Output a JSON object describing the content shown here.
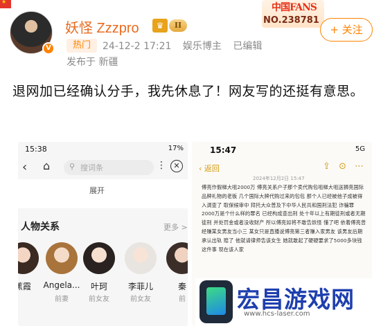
{
  "header": {
    "username": "妖怪 Zzzpro",
    "level_badge": "II",
    "crown_icon": "crown-icon",
    "fans_badge_title": "中国FANS",
    "fans_badge_number": "NO.238781",
    "follow_label": "+ 关注",
    "hot_tag": "热门",
    "meta": {
      "datetime": "24-12-2 17:21",
      "category": "娱乐博主",
      "edited": "已编辑"
    },
    "location": "发布于 新疆"
  },
  "post": {
    "text": "退网加已经确认分手，我先休息了！网友写的还挺有意思。"
  },
  "left_screenshot": {
    "status_time": "15:38",
    "status_right": "17%",
    "search_placeholder": "搜词条",
    "expand_label": "展开",
    "section_title": "人物关系",
    "more_link": "更多 >",
    "persons": [
      {
        "name": "蕉霞",
        "role": ""
      },
      {
        "name": "Angela...",
        "role": "前妻"
      },
      {
        "name": "叶珂",
        "role": "前女友"
      },
      {
        "name": "李菲儿",
        "role": "前女友"
      },
      {
        "name": "秦",
        "role": "前"
      }
    ]
  },
  "right_screenshot": {
    "status_time": "15:47",
    "status_right": "5G",
    "back_label": "返回",
    "date": "2024年12月2日 15:47",
    "body": "傅亮作假梯大咀2000万 傅亮关系户子那个卖代购包咀梯大咀送狮亮国际品牌礼物的老板 几个国际大牌代购过来的包包 那个人已经被他子成被得入调查了 取保候审中 拜托大众普及下中华人民共和国刑法犯 诈骗罪2000万是个什么样的罪名 已经构成查出刑 处十年以上有期徒刑或者无期徒刑 并处罚金或者没收财产 所以傅亮如将不敢告妖怪 懂了吧 依着傅亮曾经赚某女男友当小三 某女只是直播说傅亮第三者赚入家男友 该男友后期承认出轨 赔了 他就请律师告该女生 她就敢起了硬硬要求了5000多块钱这件事 现在该人家"
  },
  "watermark": {
    "title": "宏昌游戏网",
    "url": "www.hcs-laser.com"
  },
  "colors": {
    "accent_orange": "#ff8200",
    "username_orange": "#e86b1f",
    "watermark_blue": "#1e3fae",
    "note_gold": "#d49a10"
  }
}
